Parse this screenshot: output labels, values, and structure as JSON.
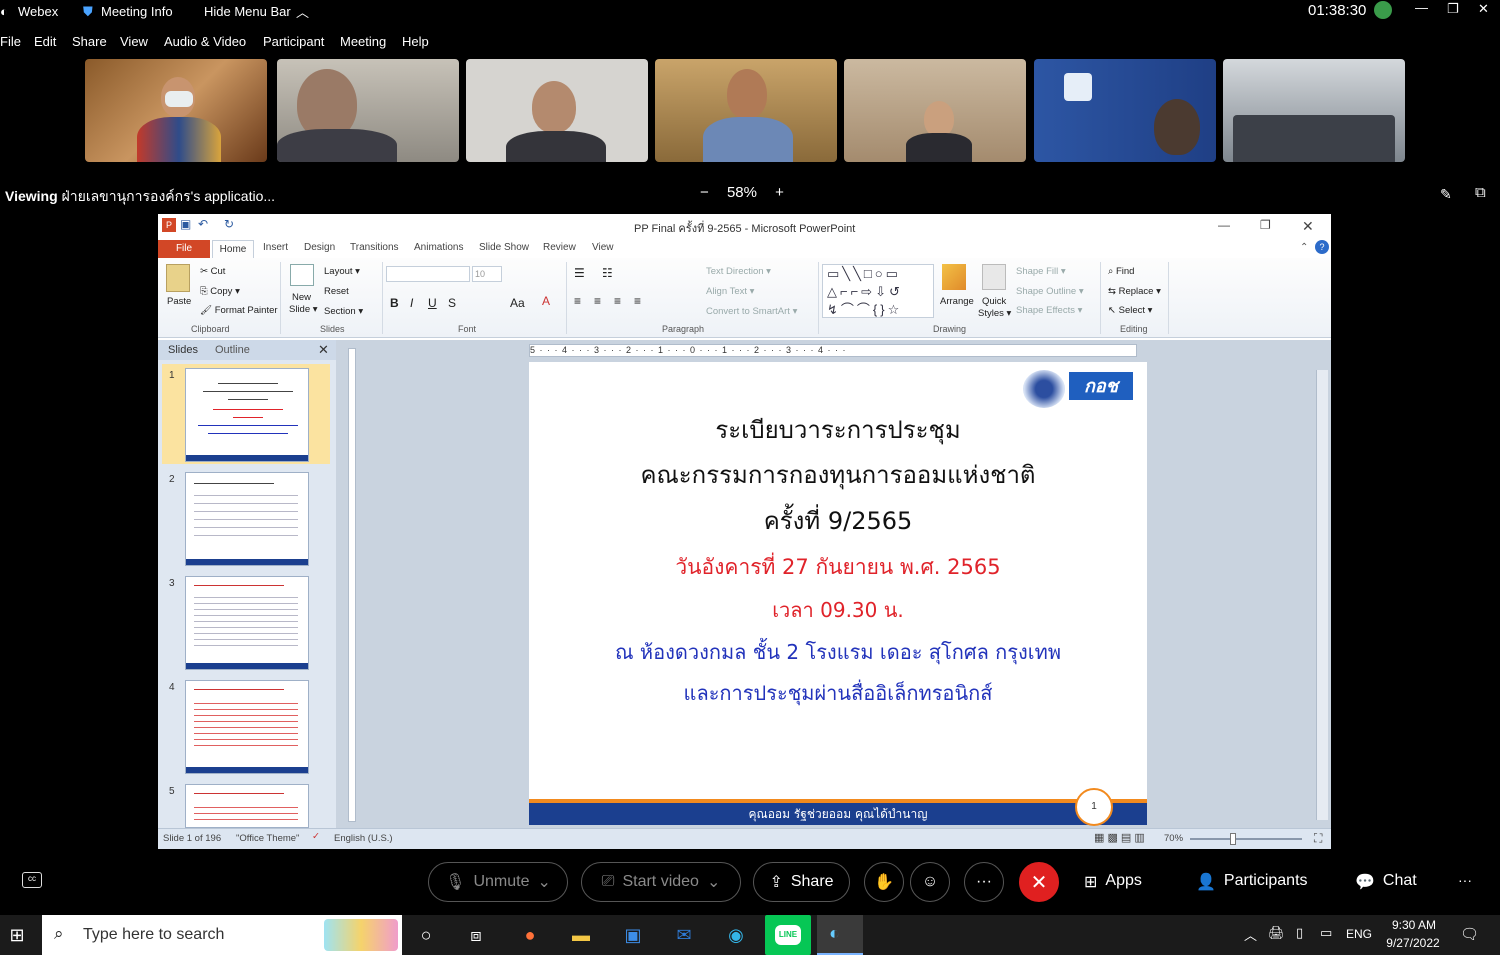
{
  "webex": {
    "app_name": "Webex",
    "meeting_info": "Meeting Info",
    "hide_menu_bar": "Hide Menu Bar",
    "timer": "01:38:30",
    "menu": [
      "File",
      "Edit",
      "Share",
      "View",
      "Audio & Video",
      "Participant",
      "Meeting",
      "Help"
    ],
    "viewing_label": "Viewing",
    "viewing_name": "ฝ่ายเลขานุการองค์กร's applicatio...",
    "zoom_minus": "−",
    "zoom_level": "58%",
    "zoom_plus": "+",
    "controls": {
      "unmute": "Unmute",
      "start_video": "Start video",
      "share": "Share",
      "apps": "Apps",
      "participants": "Participants",
      "chat": "Chat",
      "more": "···"
    }
  },
  "powerpoint": {
    "title": "PP Final ครั้งที่ 9-2565 - Microsoft PowerPoint",
    "tabs": [
      "File",
      "Home",
      "Insert",
      "Design",
      "Transitions",
      "Animations",
      "Slide Show",
      "Review",
      "View"
    ],
    "ribbon": {
      "clipboard": {
        "label": "Clipboard",
        "paste": "Paste",
        "cut": "Cut",
        "copy": "Copy ▾",
        "format_painter": "Format Painter"
      },
      "slides": {
        "label": "Slides",
        "new_slide": "New",
        "new_slide2": "Slide ▾",
        "layout": "Layout ▾",
        "reset": "Reset",
        "section": "Section ▾"
      },
      "font": {
        "label": "Font",
        "size": "10"
      },
      "paragraph": {
        "label": "Paragraph",
        "text_direction": "Text Direction ▾",
        "align_text": "Align Text ▾",
        "smartart": "Convert to SmartArt ▾"
      },
      "drawing": {
        "label": "Drawing",
        "arrange": "Arrange",
        "quick_styles": "Quick",
        "quick_styles2": "Styles ▾",
        "shape_fill": "Shape Fill ▾",
        "shape_outline": "Shape Outline ▾",
        "shape_effects": "Shape Effects ▾"
      },
      "editing": {
        "label": "Editing",
        "find": "Find",
        "replace": "Replace ▾",
        "select": "Select ▾"
      }
    },
    "panel_tabs": [
      "Slides",
      "Outline"
    ],
    "thumbnails": [
      "1",
      "2",
      "3",
      "4",
      "5"
    ],
    "ruler_text": "5 · · · 4 · · · 3 · · · 2 · · · 1 · · · 0 · · · 1 · · · 2 · · · 3 · · · 4 · · ·",
    "slide": {
      "line1": "ระเบียบวาระการประชุม",
      "line2": "คณะกรรมการกองทุนการออมแห่งชาติ",
      "line3": "ครั้งที่ 9/2565",
      "line4": "วันอังคารที่ 27 กันยายน พ.ศ. 2565",
      "line5": "เวลา 09.30 น.",
      "line6": "ณ ห้องดวงกมล ชั้น 2 โรงแรม เดอะ สุโกศล กรุงเทพ",
      "line7": "และการประชุมผ่านสื่ออิเล็กทรอนิกส์",
      "logo_text": "กอช",
      "footer": "คุณออม รัฐช่วยออม คุณได้บำนาญ",
      "page_num": "1"
    },
    "status": {
      "slide": "Slide 1 of 196",
      "theme": "\"Office Theme\"",
      "lang": "English (U.S.)",
      "zoom": "70%"
    }
  },
  "taskbar": {
    "search_placeholder": "Type here to search",
    "lang": "ENG",
    "time": "9:30 AM",
    "date": "9/27/2022"
  },
  "colors": {
    "slide_red": "#e0232a",
    "slide_blue": "#2233bb",
    "footer_blue": "#1b3f8f",
    "footer_orange": "#f28a1e",
    "end_call": "#e02020",
    "taskbar_green": "#06c755"
  }
}
